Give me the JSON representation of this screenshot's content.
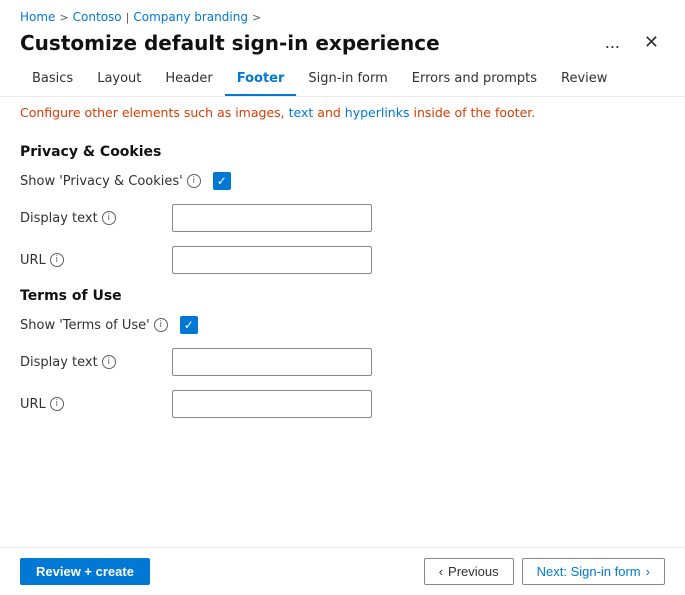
{
  "breadcrumb": {
    "home": "Home",
    "contoso": "Contoso",
    "separator1": ">",
    "company_branding": "Company branding",
    "separator2": ">"
  },
  "header": {
    "title": "Customize default sign-in experience",
    "more_label": "...",
    "close_label": "✕"
  },
  "tabs": [
    {
      "id": "basics",
      "label": "Basics",
      "active": false
    },
    {
      "id": "layout",
      "label": "Layout",
      "active": false
    },
    {
      "id": "header",
      "label": "Header",
      "active": false
    },
    {
      "id": "footer",
      "label": "Footer",
      "active": true
    },
    {
      "id": "signin-form",
      "label": "Sign-in form",
      "active": false
    },
    {
      "id": "errors-prompts",
      "label": "Errors and prompts",
      "active": false
    },
    {
      "id": "review",
      "label": "Review",
      "active": false
    }
  ],
  "info_bar": {
    "text_before": "Configure other elements such as images,",
    "link1": "text",
    "text_middle": "and",
    "link2": "hyperlinks",
    "text_after": "inside of the footer."
  },
  "sections": {
    "privacy_cookies": {
      "title": "Privacy & Cookies",
      "show_label": "Show 'Privacy & Cookies'",
      "display_text_label": "Display text",
      "url_label": "URL",
      "show_checked": true,
      "display_text_value": "",
      "display_text_placeholder": "",
      "url_value": "",
      "url_placeholder": ""
    },
    "terms_of_use": {
      "title": "Terms of Use",
      "show_label": "Show 'Terms of Use'",
      "display_text_label": "Display text",
      "url_label": "URL",
      "show_checked": true,
      "display_text_value": "",
      "display_text_placeholder": "",
      "url_value": "",
      "url_placeholder": ""
    }
  },
  "footer": {
    "review_create_label": "Review + create",
    "previous_label": "Previous",
    "next_label": "Next: Sign-in form"
  }
}
